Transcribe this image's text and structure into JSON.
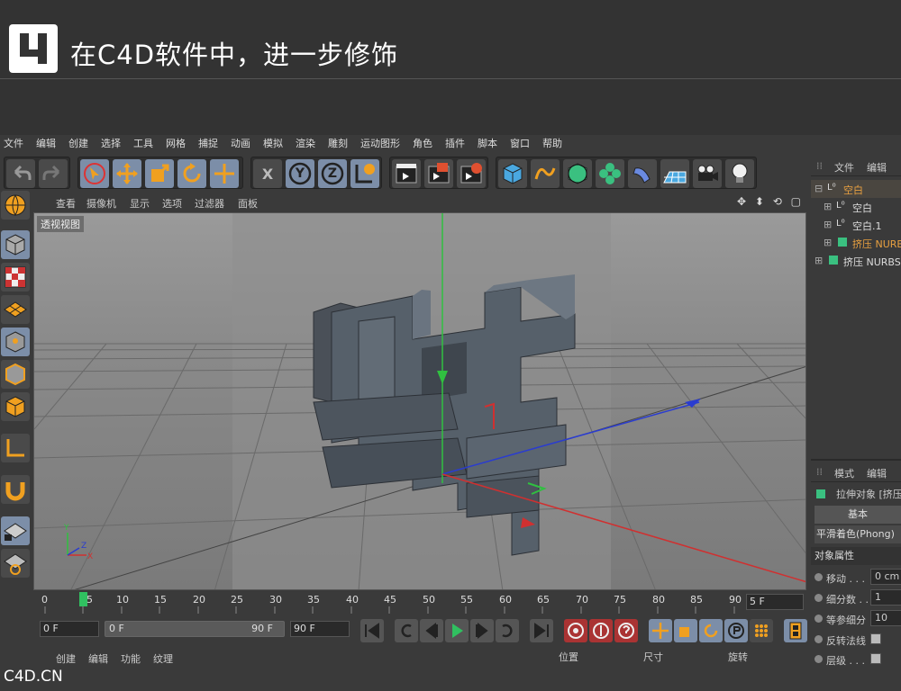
{
  "banner": {
    "step_number": "4",
    "title": "在C4D软件中，进一步修饰"
  },
  "menu": [
    "文件",
    "编辑",
    "创建",
    "选择",
    "工具",
    "网格",
    "捕捉",
    "动画",
    "模拟",
    "渲染",
    "雕刻",
    "运动图形",
    "角色",
    "插件",
    "脚本",
    "窗口",
    "帮助"
  ],
  "toolbar": {
    "x_label": "X",
    "y_label": "Y",
    "z_label": "Z"
  },
  "viewport_menu": [
    "查看",
    "摄像机",
    "显示",
    "选项",
    "过滤器",
    "面板"
  ],
  "viewport": {
    "label": "透视视图",
    "nav_icons": "✥ ⬍ ⟲ ▢"
  },
  "axis_gizmo": {
    "x": "X",
    "y": "Y",
    "z": "Z"
  },
  "timeline": {
    "ticks": [
      "0",
      "5",
      "10",
      "15",
      "20",
      "25",
      "30",
      "35",
      "40",
      "45",
      "50",
      "55",
      "60",
      "65",
      "70",
      "75",
      "80",
      "85",
      "90"
    ],
    "current_frame_label": "5 F",
    "start": "0 F",
    "range_start": "0 F",
    "range_end": "90 F",
    "end": "90 F"
  },
  "bottom_bar": [
    "创建",
    "编辑",
    "功能",
    "纹理"
  ],
  "coord_headers": [
    "位置",
    "尺寸",
    "旋转"
  ],
  "object_panel": {
    "tabs": [
      "文件",
      "编辑"
    ],
    "objects": [
      {
        "name": "空白",
        "color": "#e8a040",
        "indent": 0
      },
      {
        "name": "空白",
        "color": "#dddddd",
        "indent": 1
      },
      {
        "name": "空白.1",
        "color": "#dddddd",
        "indent": 1
      },
      {
        "name": "挤压 NURB",
        "color": "#e8a040",
        "indent": 1
      },
      {
        "name": "挤压 NURBS",
        "color": "#dddddd",
        "indent": 0
      }
    ]
  },
  "attr_panel": {
    "tabs": [
      "模式",
      "编辑"
    ],
    "object_title": "拉伸对象 [挤压",
    "tab_basic": "基本",
    "shading": "平滑着色(Phong)",
    "section": "对象属性",
    "rows": [
      {
        "label": "移动 . . .",
        "value": "0 cm",
        "type": "field"
      },
      {
        "label": "细分数 . .",
        "value": "1",
        "type": "field"
      },
      {
        "label": "等参细分",
        "value": "10",
        "type": "field"
      },
      {
        "label": "反转法线",
        "value": "",
        "type": "check"
      },
      {
        "label": "层级 . . .",
        "value": "",
        "type": "check"
      }
    ]
  },
  "watermark": "C4D.CN",
  "colors": {
    "accent": "#7c8ea8",
    "orange": "#f0a020",
    "viewport_bg": "#8e8e8e"
  }
}
